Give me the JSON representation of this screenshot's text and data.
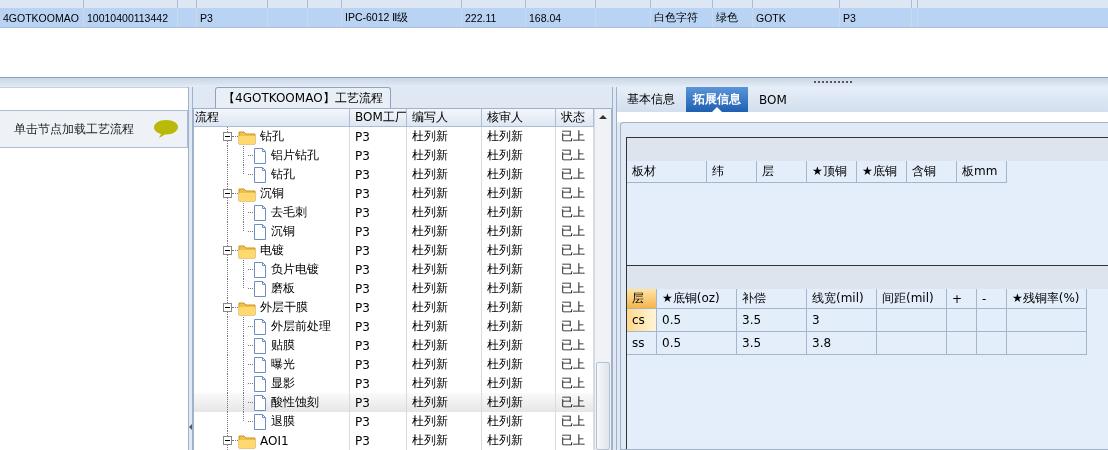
{
  "top_grid": {
    "rows": [
      {
        "selected": true,
        "cells": [
          "4GOTKOOMAO",
          "10010400113442",
          "P3",
          "IPC-6012 Ⅱ级",
          "222.11",
          "168.04",
          "白色字符",
          "绿色",
          "GOTK",
          "P3"
        ]
      }
    ]
  },
  "left_panel": {
    "hint": "单击节点加载工艺流程"
  },
  "process_panel": {
    "title": "【4GOTKOOMAO】工艺流程",
    "columns": [
      "流程",
      "BOM工厂",
      "编写人",
      "核审人",
      "状态"
    ],
    "tree": [
      {
        "kind": "folder",
        "name": "钻孔",
        "expanded": true,
        "selected": false,
        "bom": "P3",
        "writer": "杜列新",
        "reviewer": "杜列新",
        "status": "已上",
        "children": [
          {
            "kind": "file",
            "name": "铝片钻孔",
            "selected": false,
            "bom": "P3",
            "writer": "杜列新",
            "reviewer": "杜列新",
            "status": "已上"
          },
          {
            "kind": "file",
            "name": "钻孔",
            "selected": false,
            "bom": "P3",
            "writer": "杜列新",
            "reviewer": "杜列新",
            "status": "已上"
          }
        ]
      },
      {
        "kind": "folder",
        "name": "沉铜",
        "expanded": true,
        "selected": false,
        "bom": "P3",
        "writer": "杜列新",
        "reviewer": "杜列新",
        "status": "已上",
        "children": [
          {
            "kind": "file",
            "name": "去毛刺",
            "selected": false,
            "bom": "P3",
            "writer": "杜列新",
            "reviewer": "杜列新",
            "status": "已上"
          },
          {
            "kind": "file",
            "name": "沉铜",
            "selected": false,
            "bom": "P3",
            "writer": "杜列新",
            "reviewer": "杜列新",
            "status": "已上"
          }
        ]
      },
      {
        "kind": "folder",
        "name": "电镀",
        "expanded": true,
        "selected": false,
        "bom": "P3",
        "writer": "杜列新",
        "reviewer": "杜列新",
        "status": "已上",
        "children": [
          {
            "kind": "file",
            "name": "负片电镀",
            "selected": false,
            "bom": "P3",
            "writer": "杜列新",
            "reviewer": "杜列新",
            "status": "已上"
          },
          {
            "kind": "file",
            "name": "磨板",
            "selected": false,
            "bom": "P3",
            "writer": "杜列新",
            "reviewer": "杜列新",
            "status": "已上"
          }
        ]
      },
      {
        "kind": "folder",
        "name": "外层干膜",
        "expanded": true,
        "selected": false,
        "bom": "P3",
        "writer": "杜列新",
        "reviewer": "杜列新",
        "status": "已上",
        "children": [
          {
            "kind": "file",
            "name": "外层前处理",
            "selected": false,
            "bom": "P3",
            "writer": "杜列新",
            "reviewer": "杜列新",
            "status": "已上"
          },
          {
            "kind": "file",
            "name": "贴膜",
            "selected": false,
            "bom": "P3",
            "writer": "杜列新",
            "reviewer": "杜列新",
            "status": "已上"
          },
          {
            "kind": "file",
            "name": "曝光",
            "selected": false,
            "bom": "P3",
            "writer": "杜列新",
            "reviewer": "杜列新",
            "status": "已上"
          },
          {
            "kind": "file",
            "name": "显影",
            "selected": false,
            "bom": "P3",
            "writer": "杜列新",
            "reviewer": "杜列新",
            "status": "已上"
          },
          {
            "kind": "file",
            "name": "酸性蚀刻",
            "selected": true,
            "bom": "P3",
            "writer": "杜列新",
            "reviewer": "杜列新",
            "status": "已上"
          },
          {
            "kind": "file",
            "name": "退膜",
            "selected": false,
            "bom": "P3",
            "writer": "杜列新",
            "reviewer": "杜列新",
            "status": "已上"
          }
        ]
      },
      {
        "kind": "folder",
        "name": "AOI1",
        "expanded": true,
        "selected": false,
        "bom": "P3",
        "writer": "杜列新",
        "reviewer": "杜列新",
        "status": "已上"
      }
    ]
  },
  "detail_panel": {
    "tabs": [
      {
        "label": "基本信息",
        "selected": false
      },
      {
        "label": "拓展信息",
        "selected": true
      },
      {
        "label": "BOM",
        "selected": false
      }
    ],
    "material_table": {
      "columns": [
        "板材",
        "纬",
        "层",
        "★顶铜",
        "★底铜",
        "含铜",
        "板mm"
      ]
    },
    "layer_table": {
      "columns": [
        "层",
        "★底铜(oz)",
        "补偿",
        "线宽(mil)",
        "间距(mil)",
        "+",
        "-",
        "★残铜率(%)"
      ],
      "rows": [
        {
          "selected": true,
          "cells": [
            "cs",
            "0.5",
            "3.5",
            "3"
          ]
        },
        {
          "selected": false,
          "cells": [
            "ss",
            "0.5",
            "3.5",
            "3.8"
          ]
        }
      ]
    }
  }
}
